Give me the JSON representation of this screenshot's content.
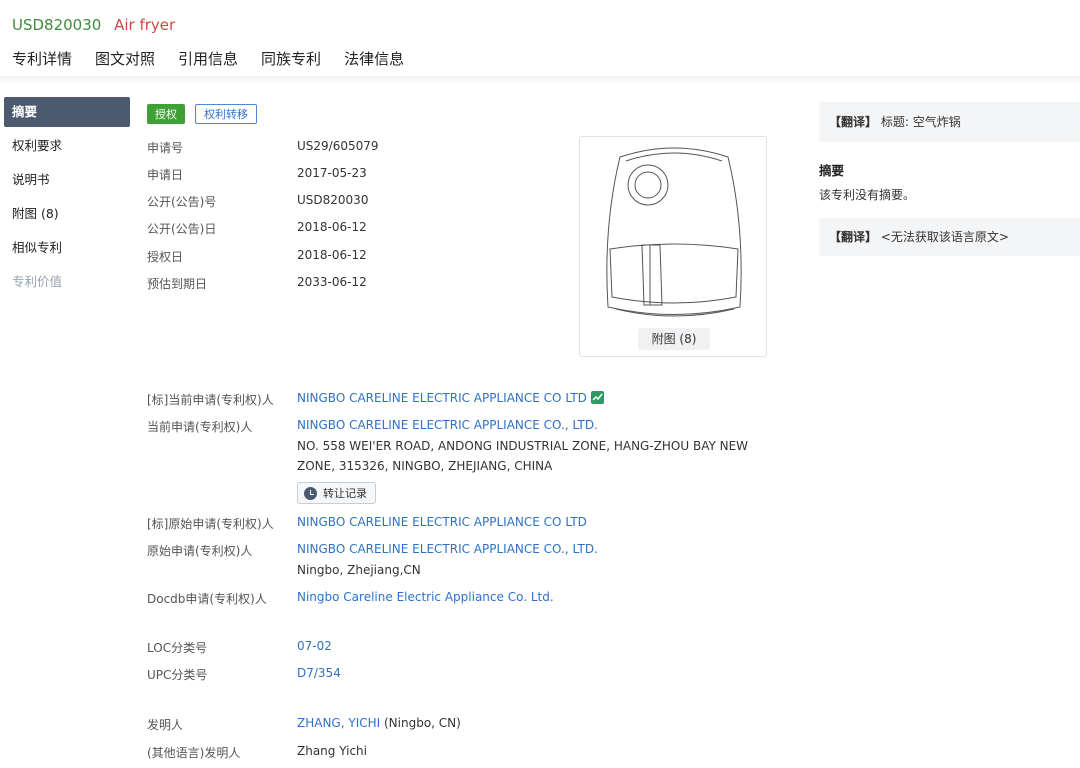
{
  "header": {
    "patent_number": "USD820030",
    "title": "Air fryer"
  },
  "tabs": [
    "专利详情",
    "图文对照",
    "引用信息",
    "同族专利",
    "法律信息"
  ],
  "sidebar": {
    "items": [
      "摘要",
      "权利要求",
      "说明书",
      "附图 (8)",
      "相似专利",
      "专利价值"
    ]
  },
  "badges": {
    "status": "授权",
    "transfer": "权利转移"
  },
  "basic": {
    "app_no_label": "申请号",
    "app_no": "US29/605079",
    "app_date_label": "申请日",
    "app_date": "2017-05-23",
    "pub_no_label": "公开(公告)号",
    "pub_no": "USD820030",
    "pub_date_label": "公开(公告)日",
    "pub_date": "2018-06-12",
    "grant_date_label": "授权日",
    "grant_date": "2018-06-12",
    "expiry_label": "预估到期日",
    "expiry": "2033-06-12"
  },
  "figure": {
    "caption": "附图 (8)"
  },
  "applicants": {
    "std_current_label": "[标]当前申请(专利权)人",
    "std_current": "NINGBO CARELINE ELECTRIC APPLIANCE CO LTD",
    "current_label": "当前申请(专利权)人",
    "current": "NINGBO CARELINE ELECTRIC APPLIANCE CO., LTD.",
    "current_address_1": "NO. 558 WEI'ER ROAD, ANDONG INDUSTRIAL ZONE, HANG-ZHOU BAY NEW",
    "current_address_2": "ZONE, 315326, NINGBO, ZHEJIANG, CHINA",
    "transfer_button": "转让记录",
    "std_original_label": "[标]原始申请(专利权)人",
    "std_original": "NINGBO CARELINE ELECTRIC APPLIANCE CO LTD",
    "original_label": "原始申请(专利权)人",
    "original": "NINGBO CARELINE ELECTRIC APPLIANCE CO., LTD.",
    "original_location": "Ningbo, Zhejiang,CN",
    "docdb_label": "Docdb申请(专利权)人",
    "docdb": "Ningbo Careline Electric Appliance Co. Ltd."
  },
  "classification": {
    "loc_label": "LOC分类号",
    "loc": "07-02",
    "upc_label": "UPC分类号",
    "upc": "D7/354"
  },
  "inventors": {
    "inventor_label": "发明人",
    "inventor": "ZHANG, YICHI",
    "inventor_loc": "(Ningbo, CN)",
    "other_lang_label": "(其他语言)发明人",
    "other_lang": "Zhang Yichi"
  },
  "right_panel": {
    "translate_tag": "【翻译】",
    "title_translation": "标题: 空气炸锅",
    "abstract_heading": "摘要",
    "abstract_text": "该专利没有摘要。",
    "abstract_translation": "<无法获取该语言原文>"
  },
  "colors": {
    "accent_blue": "#2f72c4",
    "green": "#3fa135",
    "sidebar_active": "#4b5a6e",
    "title_red": "#d04545"
  }
}
